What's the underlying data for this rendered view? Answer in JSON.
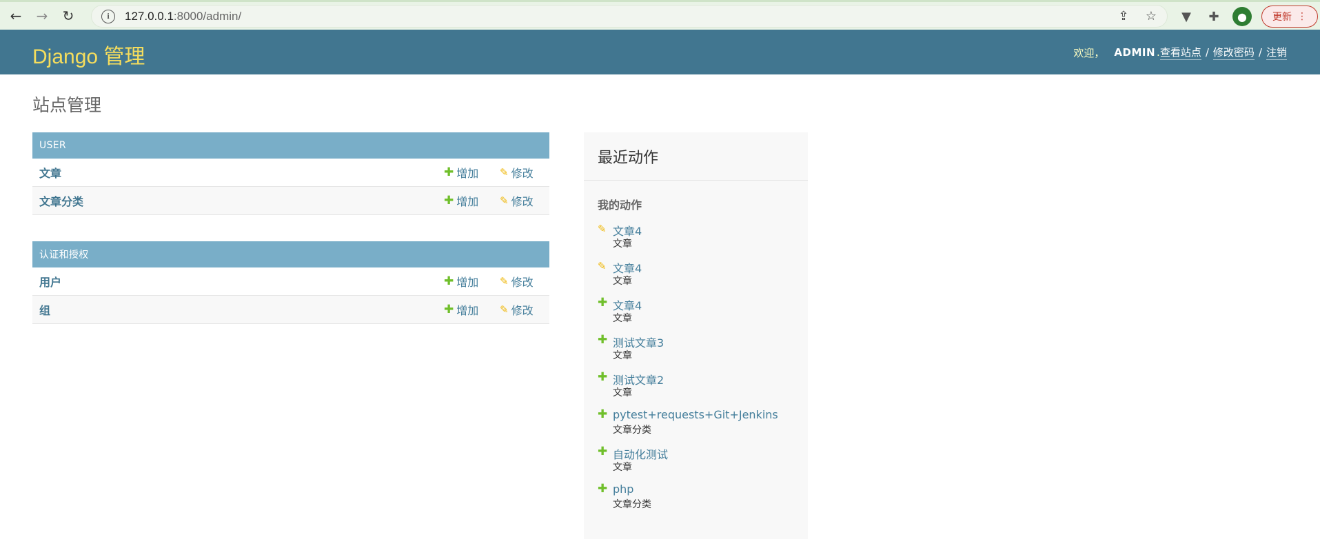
{
  "browser": {
    "url_host": "127.0.0.1",
    "url_path": ":8000/admin/",
    "update_label": "更新"
  },
  "header": {
    "branding": "Django 管理",
    "welcome": "欢迎，",
    "username": "ADMIN",
    "username_suffix": ".",
    "view_site": "查看站点",
    "change_password": "修改密码",
    "logout": "注销",
    "separator": "/"
  },
  "content": {
    "title": "站点管理",
    "add_label": "增加",
    "change_label": "修改"
  },
  "modules": [
    {
      "caption": "USER",
      "rows": [
        {
          "name": "文章"
        },
        {
          "name": "文章分类"
        }
      ]
    },
    {
      "caption": "认证和授权",
      "rows": [
        {
          "name": "用户"
        },
        {
          "name": "组"
        }
      ]
    }
  ],
  "recent": {
    "title": "最近动作",
    "subtitle": "我的动作",
    "actions": [
      {
        "kind": "change",
        "link": "文章4",
        "type": "文章"
      },
      {
        "kind": "change",
        "link": "文章4",
        "type": "文章"
      },
      {
        "kind": "add",
        "link": "文章4",
        "type": "文章"
      },
      {
        "kind": "add",
        "link": "测试文章3",
        "type": "文章"
      },
      {
        "kind": "add",
        "link": "测试文章2",
        "type": "文章"
      },
      {
        "kind": "add",
        "link": "pytest+requests+Git+Jenkins",
        "type": "文章分类"
      },
      {
        "kind": "add",
        "link": "自动化测试",
        "type": "文章"
      },
      {
        "kind": "add",
        "link": "php",
        "type": "文章分类"
      }
    ]
  },
  "colors": {
    "header_bg": "#417690",
    "branding": "#f5dd5d",
    "caption_bg": "#79aec8",
    "link": "#447e9b",
    "add_icon": "#70bf2b",
    "change_icon": "#efb80b"
  }
}
